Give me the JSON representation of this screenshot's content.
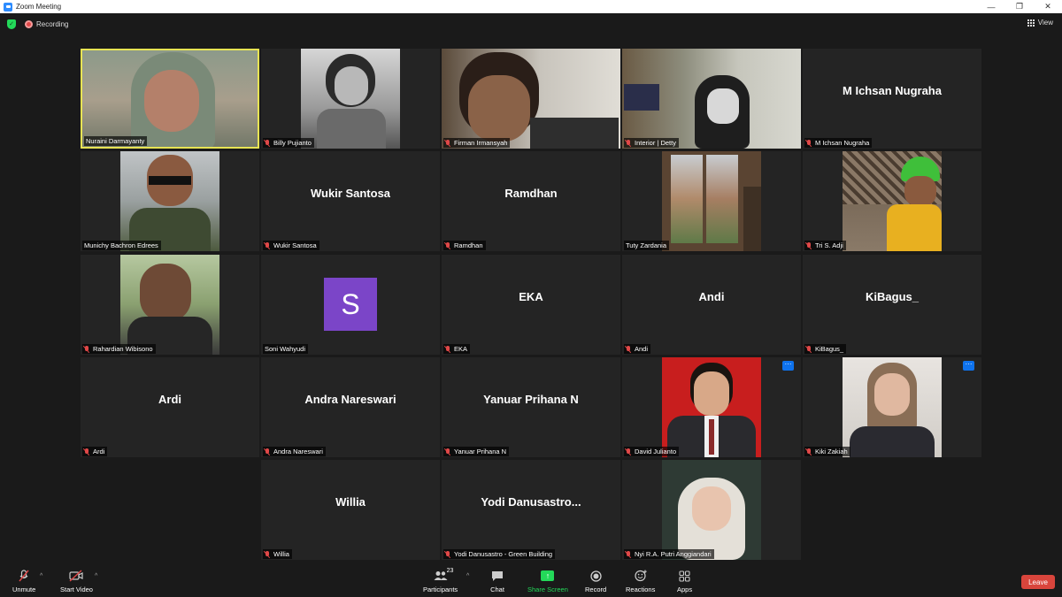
{
  "window": {
    "title": "Zoom Meeting",
    "minimize": "—",
    "restore": "❐",
    "close": "✕"
  },
  "topbar": {
    "recording_label": "Recording",
    "view_label": "View"
  },
  "tiles": [
    {
      "name": "Nuraini Darmayanty",
      "big": ""
    },
    {
      "name": "Billy Pujianto",
      "big": ""
    },
    {
      "name": "Firman Irmansyah",
      "big": ""
    },
    {
      "name": "Interior | Detty",
      "big": ""
    },
    {
      "name": "M Ichsan Nugraha",
      "big": "M Ichsan Nugraha"
    },
    {
      "name": "Munichy Bachron Edrees",
      "big": ""
    },
    {
      "name": "Wukir Santosa",
      "big": "Wukir Santosa"
    },
    {
      "name": "Ramdhan",
      "big": "Ramdhan"
    },
    {
      "name": "Tuty Zardania",
      "big": ""
    },
    {
      "name": "Tri S. Adji",
      "big": ""
    },
    {
      "name": "Rahardian Wibisono",
      "big": ""
    },
    {
      "name": "Soni Wahyudi",
      "big": "",
      "initial": "S"
    },
    {
      "name": "EKA",
      "big": "EKA"
    },
    {
      "name": "Andi",
      "big": "Andi"
    },
    {
      "name": "KiBagus_",
      "big": "KiBagus_"
    },
    {
      "name": "Ardi",
      "big": "Ardi"
    },
    {
      "name": "Andra Nareswari",
      "big": "Andra Nareswari"
    },
    {
      "name": "Yanuar Prihana N",
      "big": "Yanuar Prihana N"
    },
    {
      "name": "David Julianto",
      "big": ""
    },
    {
      "name": "Kiki Zakiah",
      "big": ""
    },
    {
      "name": "Willia",
      "big": "Willia"
    },
    {
      "name": "Yodi Danusastro - Green Building",
      "big": "Yodi  Danusastro..."
    },
    {
      "name": "Nyi R.A. Putri Anggiandari",
      "big": ""
    }
  ],
  "more_label": "···",
  "toolbar": {
    "unmute": "Unmute",
    "start_video": "Start Video",
    "participants": "Participants",
    "participants_count": "23",
    "chat": "Chat",
    "share_screen": "Share Screen",
    "record": "Record",
    "reactions": "Reactions",
    "apps": "Apps",
    "leave": "Leave",
    "caret": "^"
  },
  "colors": {
    "accent": "#2d8cff",
    "active_speaker": "#e8e454",
    "share": "#23d959",
    "leave": "#d9453c",
    "muted": "#e04848"
  }
}
